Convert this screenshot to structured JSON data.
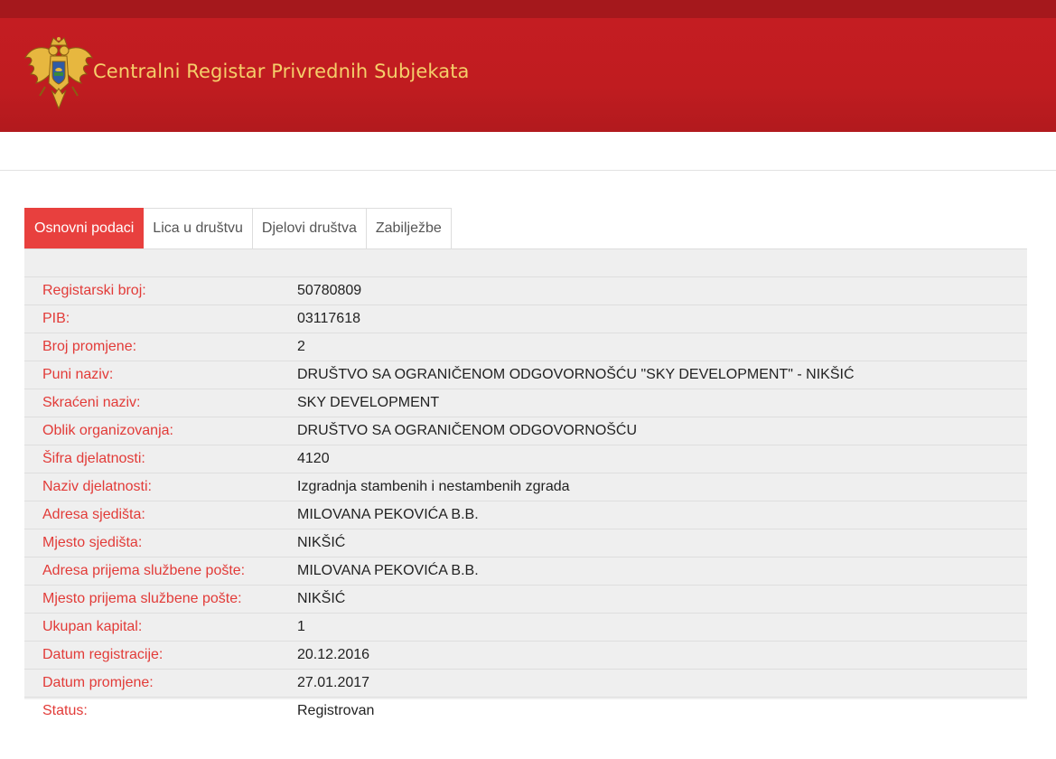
{
  "header": {
    "title": "Centralni Registar Privrednih Subjekata",
    "logo_icon": "montenegro-coat-of-arms-icon"
  },
  "colors": {
    "brand_red": "#c41d22",
    "accent_red": "#e8403e",
    "title_gold": "#f5cf6a"
  },
  "tabs": [
    {
      "label": "Osnovni podaci",
      "active": true
    },
    {
      "label": "Lica u društvu",
      "active": false
    },
    {
      "label": "Djelovi društva",
      "active": false
    },
    {
      "label": "Zabilježbe",
      "active": false
    }
  ],
  "details": [
    {
      "label": "Registarski broj:",
      "value": "50780809"
    },
    {
      "label": "PIB:",
      "value": "03117618"
    },
    {
      "label": "Broj promjene:",
      "value": "2"
    },
    {
      "label": "Puni naziv:",
      "value": "DRUŠTVO SA OGRANIČENOM ODGOVORNOŠĆU \"SKY DEVELOPMENT\" - NIKŠIĆ"
    },
    {
      "label": "Skraćeni naziv:",
      "value": "SKY DEVELOPMENT"
    },
    {
      "label": "Oblik organizovanja:",
      "value": "DRUŠTVO SA OGRANIČENOM ODGOVORNOŠĆU"
    },
    {
      "label": "Šifra djelatnosti:",
      "value": "4120"
    },
    {
      "label": "Naziv djelatnosti:",
      "value": "Izgradnja stambenih i nestambenih zgrada"
    },
    {
      "label": "Adresa sjedišta:",
      "value": "MILOVANA PEKOVIĆA B.B."
    },
    {
      "label": "Mjesto sjedišta:",
      "value": "NIKŠIĆ"
    },
    {
      "label": "Adresa prijema službene pošte:",
      "value": "MILOVANA PEKOVIĆA B.B."
    },
    {
      "label": "Mjesto prijema službene pošte:",
      "value": "NIKŠIĆ"
    },
    {
      "label": "Ukupan kapital:",
      "value": "1"
    },
    {
      "label": "Datum registracije:",
      "value": "20.12.2016"
    },
    {
      "label": "Datum promjene:",
      "value": "27.01.2017"
    },
    {
      "label": "Status:",
      "value": "Registrovan"
    }
  ]
}
